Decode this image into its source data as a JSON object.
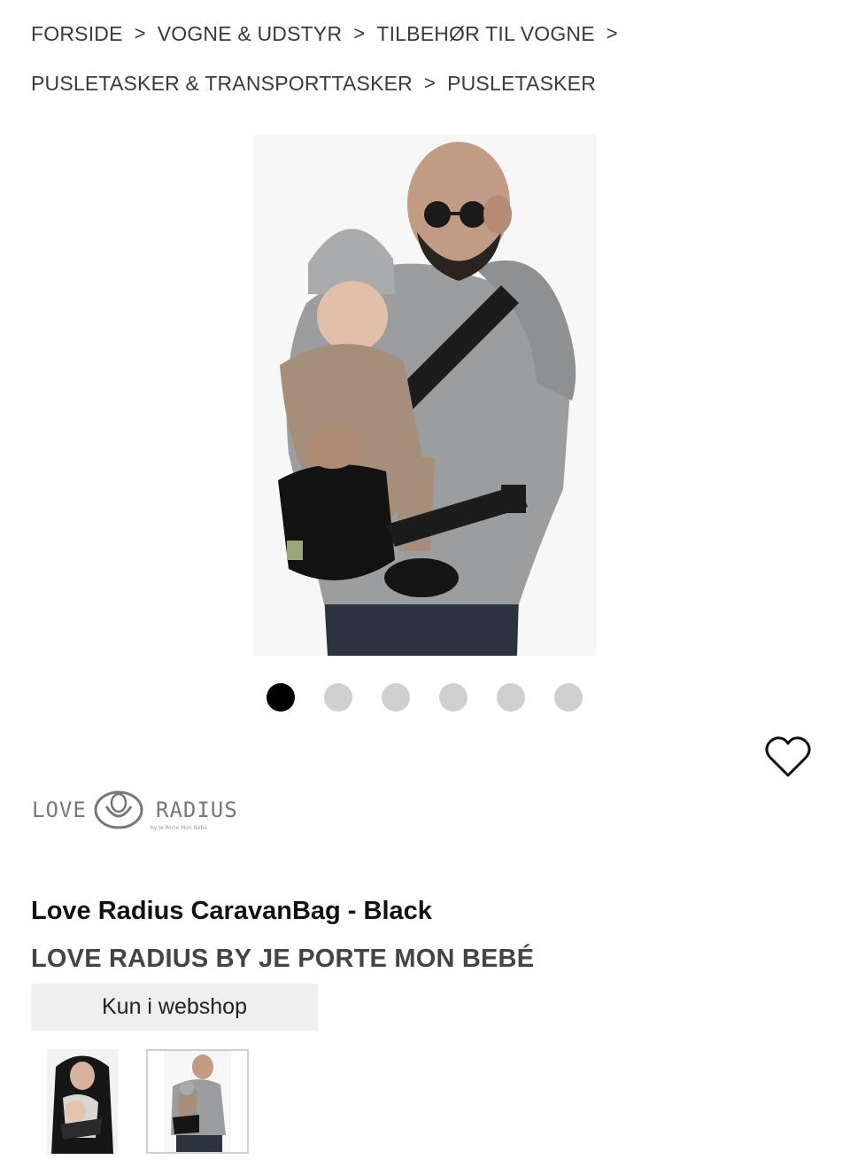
{
  "breadcrumb": {
    "items": [
      "FORSIDE",
      "VOGNE & UDSTYR",
      "TILBEHØR TIL VOGNE",
      "PUSLETASKER & TRANSPORTTASKER",
      "PUSLETASKER"
    ],
    "separator": ">"
  },
  "hero": {
    "icon": "product-photo-man-with-child-and-bag"
  },
  "carousel": {
    "total": 6,
    "active_index": 0
  },
  "wishlist": {
    "icon": "heart-outline-icon"
  },
  "brand_logo": {
    "word_left": "LOVE",
    "word_right": "RADIUS",
    "tagline": "by Je Porte Mon Bébé"
  },
  "product": {
    "title": "Love Radius CaravanBag - Black",
    "brand": "LOVE RADIUS BY JE PORTE MON BEBÉ",
    "availability": "Kun i webshop"
  },
  "thumbnails": {
    "count": 2,
    "selected_index": 1
  },
  "colors": {
    "dot_active": "#000000",
    "dot_inactive": "#cfcfcf",
    "availability_bg": "#efefef"
  }
}
